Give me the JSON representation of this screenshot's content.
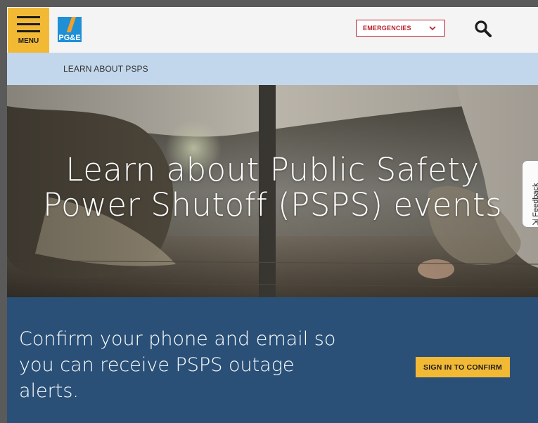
{
  "header": {
    "menu_label": "MENU",
    "logo_alt": "PG&E",
    "emergencies_label": "EMERGENCIES",
    "search_icon": "search-icon"
  },
  "breadcrumb": {
    "label": "LEARN ABOUT PSPS"
  },
  "hero": {
    "title_line1": "Learn about Public Safety",
    "title_line2": "Power Shutoff (PSPS) events"
  },
  "feedback": {
    "label": "Feedback"
  },
  "confirm": {
    "line1": "Confirm your phone and email so",
    "line2": "you can receive PSPS outage",
    "line3": "alerts.",
    "button_label": "SIGN IN TO CONFIRM"
  },
  "colors": {
    "menu_yellow": "#f2b935",
    "emergency_red": "#b8202e",
    "breadcrumb_blue": "#c2d7eb",
    "section_blue": "#2a5077",
    "logo_blue": "#1f8fd6",
    "logo_orange": "#f0a12b"
  }
}
